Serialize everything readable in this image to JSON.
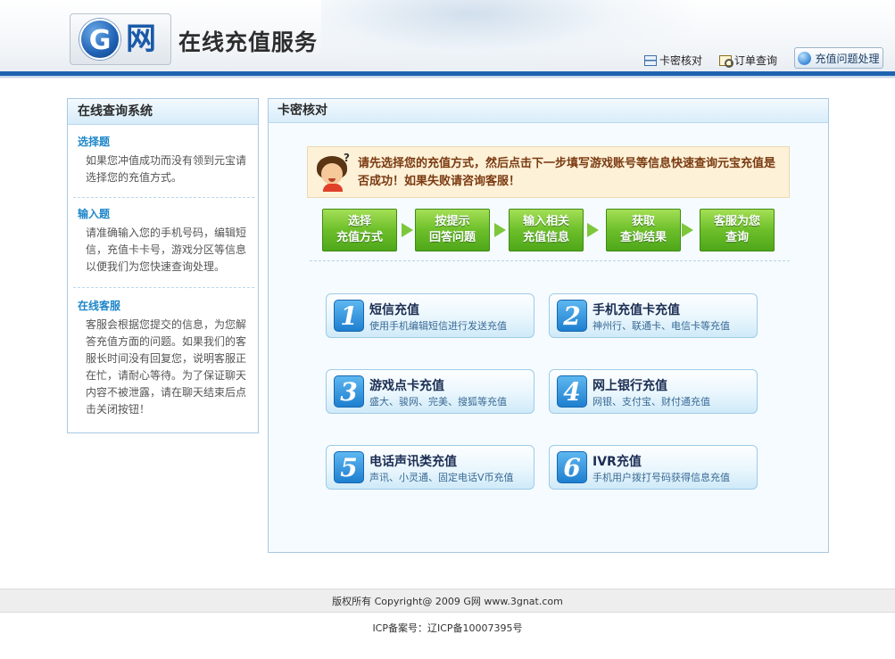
{
  "header": {
    "logo_g": "G",
    "logo_wang": "网",
    "site_title": "在线充值服务",
    "links": {
      "card_check": "卡密核对",
      "order_query": "订单查询",
      "recharge_problem": "充值问题处理"
    }
  },
  "sidebar": {
    "title": "在线查询系统",
    "sections": [
      {
        "heading": "选择题",
        "text": "如果您冲值成功而没有领到元宝请选择您的充值方式。"
      },
      {
        "heading": "输入题",
        "text": "请准确输入您的手机号码，编辑短信，充值卡卡号，游戏分区等信息以便我们为您快速查询处理。"
      },
      {
        "heading": "在线客服",
        "text": "客服会根据您提交的信息，为您解答充值方面的问题。如果我们的客服长时间没有回复您，说明客服正在忙，请耐心等待。为了保证聊天内容不被泄露，请在聊天结束后点击关闭按钮！"
      }
    ]
  },
  "main": {
    "title": "卡密核对",
    "notice": "请先选择您的充值方式，然后点击下一步填写游戏账号等信息快速查询元宝充值是否成功！如果失败请咨询客服！",
    "steps": [
      {
        "line1": "选择",
        "line2": "充值方式"
      },
      {
        "line1": "按提示",
        "line2": "回答问题"
      },
      {
        "line1": "输入相关",
        "line2": "充值信息"
      },
      {
        "line1": "获取",
        "line2": "查询结果"
      },
      {
        "line1": "客服为您",
        "line2": "查询"
      }
    ],
    "pay_methods": [
      {
        "num": "1",
        "title": "短信充值",
        "sub": "使用手机编辑短信进行发送充值"
      },
      {
        "num": "2",
        "title": "手机充值卡充值",
        "sub": "神州行、联通卡、电信卡等充值"
      },
      {
        "num": "3",
        "title": "游戏点卡充值",
        "sub": "盛大、骏网、完美、搜狐等充值"
      },
      {
        "num": "4",
        "title": "网上银行充值",
        "sub": "网银、支付宝、财付通充值"
      },
      {
        "num": "5",
        "title": "电话声讯类充值",
        "sub": "声讯、小灵通、固定电话V币充值"
      },
      {
        "num": "6",
        "title": "IVR充值",
        "sub": "手机用户拨打号码获得信息充值"
      }
    ]
  },
  "footer": {
    "copyright": "版权所有 Copyright@ 2009 G网 www.3gnat.com",
    "icp": "ICP备案号：辽ICP备10007395号"
  },
  "colors": {
    "header_bar": "#1e63b0",
    "section_heading": "#1f87c9",
    "step_green": "#6dbf2a",
    "notice_text": "#7a3a10"
  }
}
